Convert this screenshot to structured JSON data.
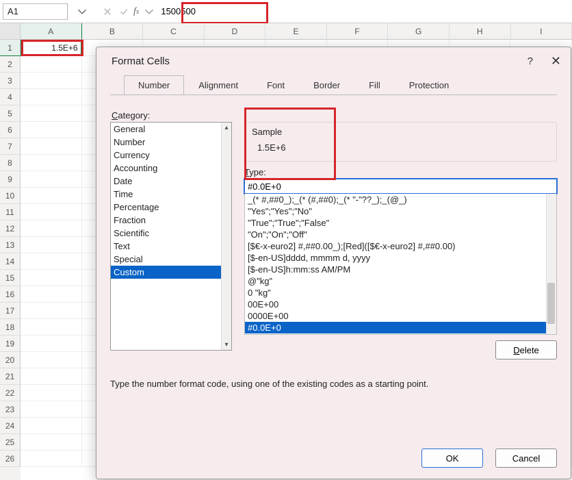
{
  "nameBox": {
    "value": "A1"
  },
  "formula": {
    "value": "1500500"
  },
  "columns": [
    "A",
    "B",
    "C",
    "D",
    "E",
    "F",
    "G",
    "H",
    "I"
  ],
  "cellA1": "1.5E+6",
  "dialog": {
    "title": "Format Cells",
    "help": "?",
    "tabs": [
      "Number",
      "Alignment",
      "Font",
      "Border",
      "Fill",
      "Protection"
    ],
    "activeTab": 0,
    "categoryLabel": "Category:",
    "categories": [
      "General",
      "Number",
      "Currency",
      "Accounting",
      "Date",
      "Time",
      "Percentage",
      "Fraction",
      "Scientific",
      "Text",
      "Special",
      "Custom"
    ],
    "selectedCategoryIndex": 11,
    "sampleLabel": "Sample",
    "sampleValue": "1.5E+6",
    "typeLabel": "Type:",
    "typeValue": "#0.0E+0",
    "typeList": [
      "_(* #,##0_);_(* (#,##0);_(* \"-\"??_);_(@_)",
      "\"Yes\";\"Yes\";\"No\"",
      "\"True\";\"True\";\"False\"",
      "\"On\";\"On\";\"Off\"",
      "[$€-x-euro2] #,##0.00_);[Red]([$€-x-euro2] #,##0.00)",
      "[$-en-US]dddd, mmmm d, yyyy",
      "[$-en-US]h:mm:ss AM/PM",
      "@\"kg\"",
      "0 \"kg\"",
      "00E+00",
      "0000E+00",
      "#0.0E+0"
    ],
    "selectedTypeIndex": 11,
    "deleteLabel": "Delete",
    "hint": "Type the number format code, using one of the existing codes as a starting point.",
    "okLabel": "OK",
    "cancelLabel": "Cancel"
  },
  "chart_data": null
}
